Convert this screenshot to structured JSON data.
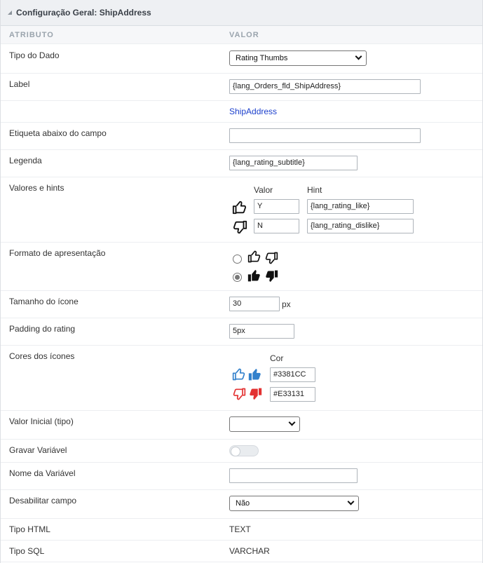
{
  "panel": {
    "title": "Configuração Geral: ShipAddress"
  },
  "columns": {
    "attribute": "ATRIBUTO",
    "value": "VALOR"
  },
  "rows": {
    "data_type": {
      "label": "Tipo do Dado",
      "value": "Rating Thumbs"
    },
    "label": {
      "label": "Label",
      "value": "{lang_Orders_fld_ShipAddress}",
      "preview": "ShipAddress"
    },
    "below_label": {
      "label": "Etiqueta abaixo do campo",
      "value": ""
    },
    "legend": {
      "label": "Legenda",
      "value": "{lang_rating_subtitle}"
    },
    "values_hints": {
      "label": "Valores e hints",
      "value_header": "Valor",
      "hint_header": "Hint",
      "items": [
        {
          "icon": "thumbs-up-outline-icon",
          "value": "Y",
          "hint": "{lang_rating_like}"
        },
        {
          "icon": "thumbs-down-outline-icon",
          "value": "N",
          "hint": "{lang_rating_dislike}"
        }
      ]
    },
    "display_format": {
      "label": "Formato de apresentação",
      "selected_index": 1
    },
    "icon_size": {
      "label": "Tamanho do ícone",
      "value": "30",
      "unit": "px"
    },
    "padding": {
      "label": "Padding do rating",
      "value": "5px"
    },
    "icon_colors": {
      "label": "Cores dos ícones",
      "header": "Cor",
      "like_color": "#3381CC",
      "dislike_color": "#E33131"
    },
    "initial_value": {
      "label": "Valor Inicial (tipo)",
      "value": ""
    },
    "save_variable": {
      "label": "Gravar Variável",
      "enabled": false
    },
    "variable_name": {
      "label": "Nome da Variável",
      "value": ""
    },
    "disable_field": {
      "label": "Desabilitar campo",
      "value": "Não"
    },
    "html_type": {
      "label": "Tipo HTML",
      "value": "TEXT"
    },
    "sql_type": {
      "label": "Tipo SQL",
      "value": "VARCHAR"
    }
  }
}
